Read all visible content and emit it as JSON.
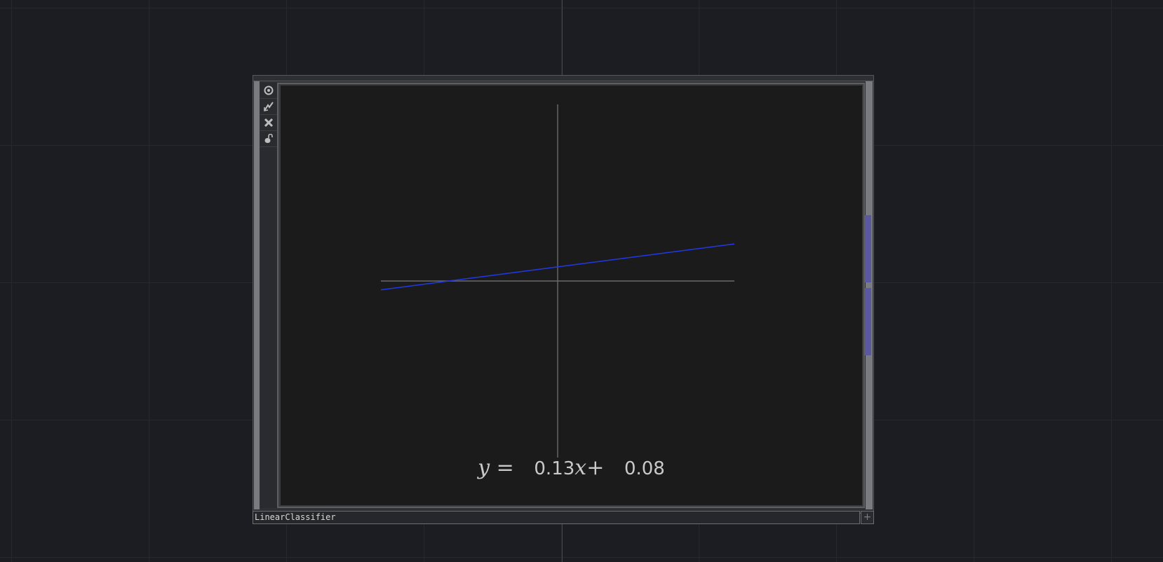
{
  "node": {
    "name": "LinearClassifier",
    "toolbar": [
      {
        "name": "viewer-toggle-icon",
        "icon": "target-icon"
      },
      {
        "name": "bypass-icon",
        "icon": "lightning-icon"
      },
      {
        "name": "close-icon",
        "icon": "x-icon"
      },
      {
        "name": "lock-icon",
        "icon": "lock-icon"
      }
    ],
    "add_button_glyph": "+"
  },
  "viewer": {
    "equation": {
      "y_symbol": "y",
      "equals": "=",
      "slope": "0.13",
      "x_symbol": "x",
      "plus": "+",
      "intercept": "0.08"
    }
  },
  "chart_data": {
    "type": "line",
    "title": "",
    "xlabel": "",
    "ylabel": "",
    "xlim": [
      -1,
      1
    ],
    "ylim": [
      -1,
      1
    ],
    "grid": false,
    "axes_visible": true,
    "series": [
      {
        "x": [
          -1,
          1
        ],
        "y": [
          -0.05,
          0.21
        ],
        "color": "#2438e8"
      }
    ]
  },
  "colors": {
    "background": "#1b1d22",
    "axes": "#6a6a6a",
    "line": "#2438e8",
    "rail_tab": "#5a58a0"
  }
}
